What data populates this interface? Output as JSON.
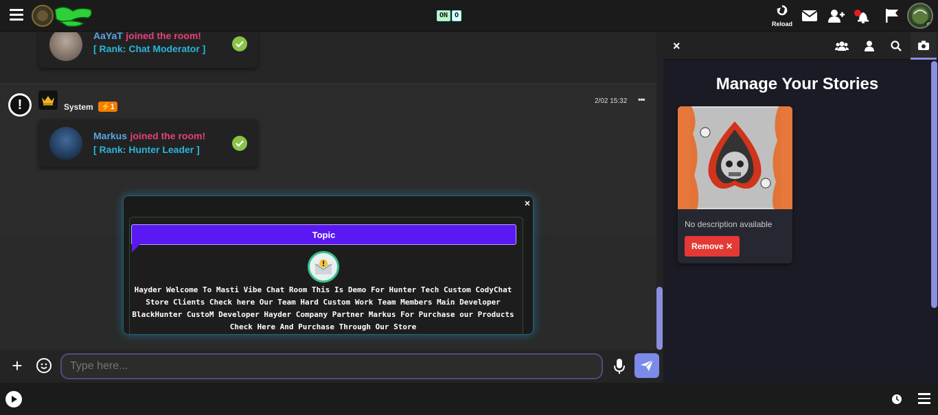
{
  "topbar": {
    "toggle_on": "ON",
    "toggle_off": "O",
    "reload_label": "Reload"
  },
  "chat": {
    "messages": [
      {
        "user": "AaYaT",
        "action": "joined the room!",
        "rank": "[ Rank: Chat Moderator ]"
      },
      {
        "user": "Markus",
        "action": "joined the room!",
        "rank": "[ Rank: Hunter Leader ]"
      }
    ],
    "system": {
      "name": "System",
      "badge": "⚡1",
      "time": "2/02 15:32",
      "more": "•••"
    },
    "topic": {
      "title": "Topic",
      "close": "×",
      "text": "Hayder Welcome To Masti Vibe Chat Room This Is Demo For Hunter Tech Custom CodyChat Store Clients Check here Our Team Hard Custom Work Team Members Main Developer BlackHunter CustoM Developer Hayder Company Partner Markus For Purchase our Products Check Here And Purchase Through Our Store"
    },
    "input": {
      "placeholder": "Type here...",
      "value": "",
      "plus": "+"
    }
  },
  "panel": {
    "close": "×",
    "title": "Manage Your Stories",
    "stories": [
      {
        "description": "No description available",
        "remove_label": "Remove ✕"
      }
    ]
  },
  "colors": {
    "accent": "#8a8fe0",
    "topic_bar": "#5a18f2",
    "remove": "#e53935",
    "joined": "#e84079",
    "rank": "#29b6d9"
  }
}
